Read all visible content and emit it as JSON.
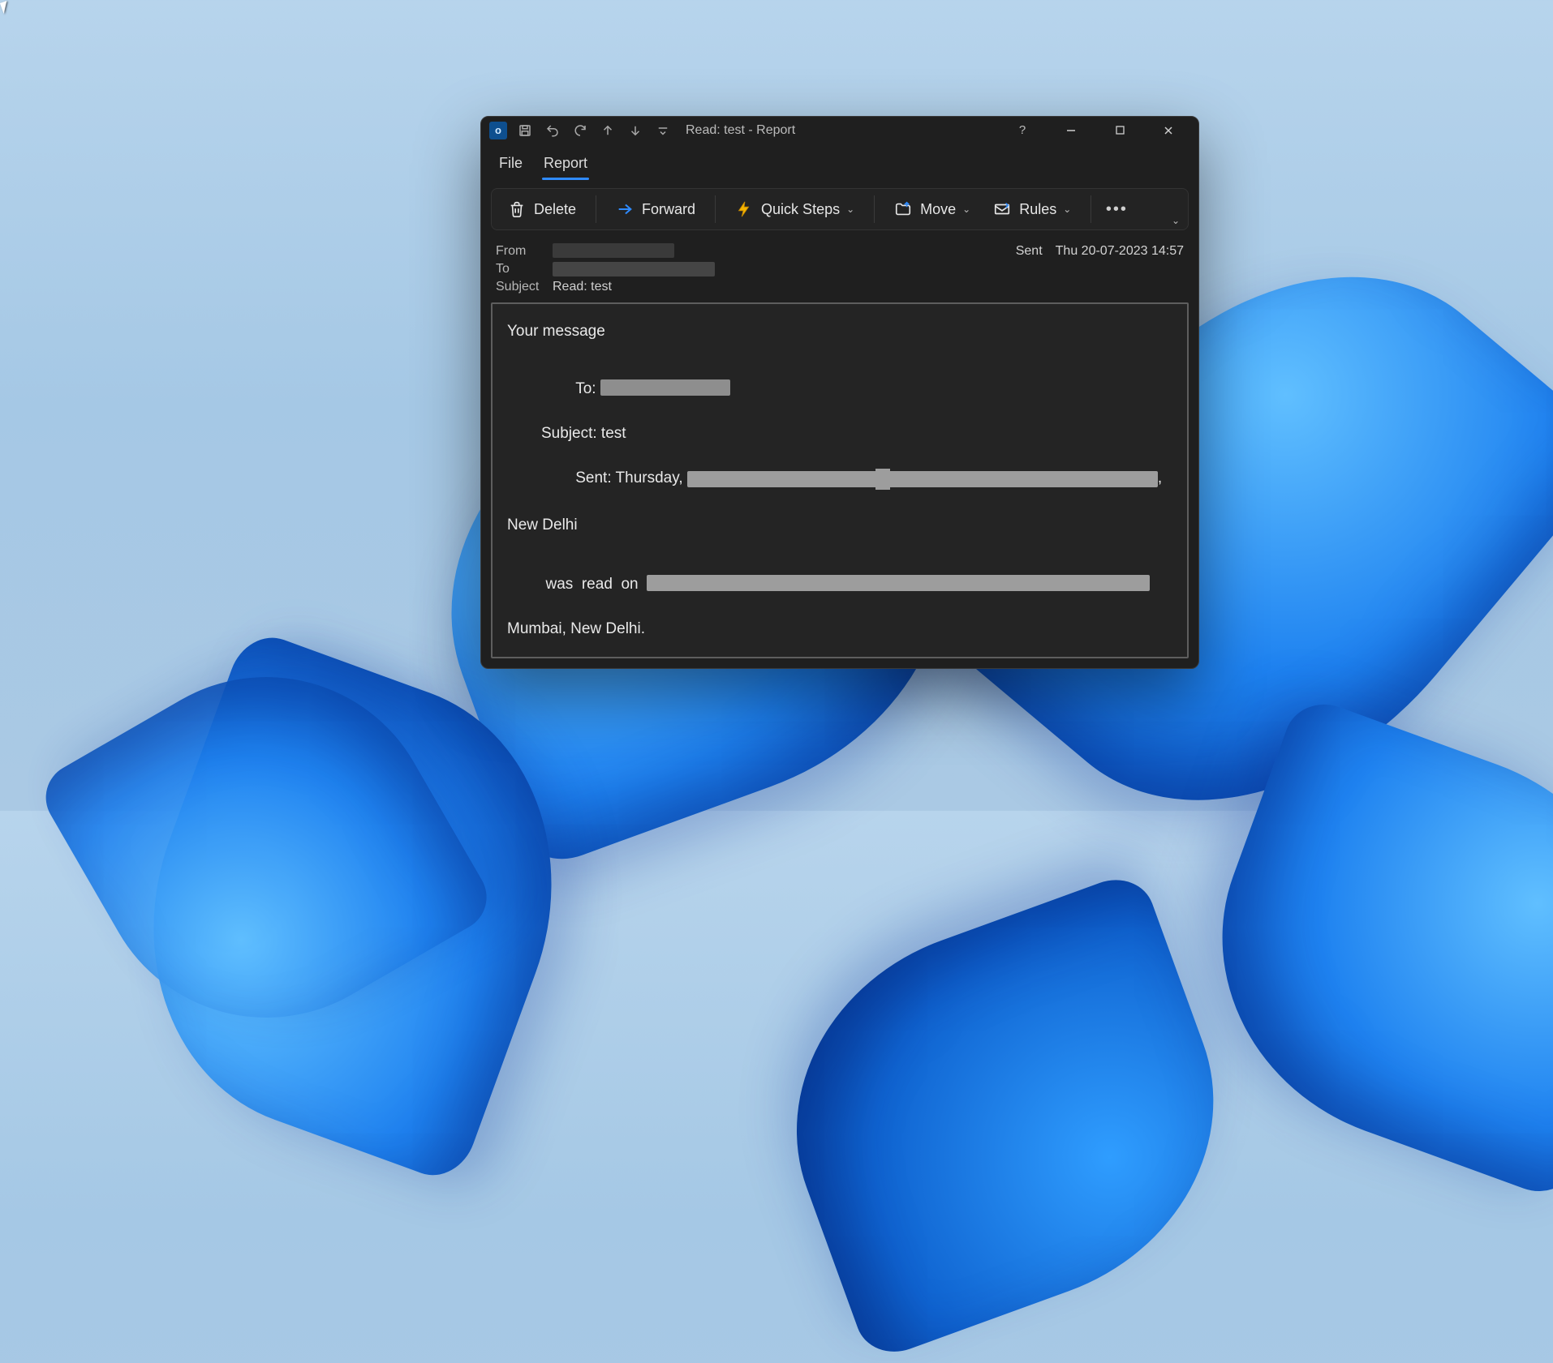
{
  "titlebar": {
    "app_glyph": "o",
    "title": "Read: test  -  Report"
  },
  "tabs": {
    "file": "File",
    "report": "Report"
  },
  "ribbon": {
    "delete": "Delete",
    "forward": "Forward",
    "quick_steps": "Quick Steps",
    "move": "Move",
    "rules": "Rules"
  },
  "header": {
    "from_lbl": "From",
    "to_lbl": "To",
    "subject_lbl": "Subject",
    "subject_val": "Read: test",
    "sent_lbl": "Sent",
    "sent_val": "Thu 20-07-2023 14:57"
  },
  "body": {
    "your_message": "Your message",
    "to_prefix": "To: ",
    "subject_line": "Subject: test",
    "sent_prefix": "Sent: Thursday, ",
    "sent_suffix": ",",
    "new_delhi": "New Delhi",
    "read_on_prefix": " was  read  on  ",
    "mumbai_line": "Mumbai, New Delhi."
  }
}
